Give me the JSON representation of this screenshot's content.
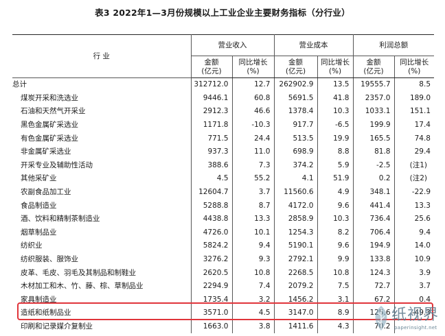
{
  "title": "表3  2022年1—3月份规模以上工业企业主要财务指标（分行业）",
  "header": {
    "industry": "行    业",
    "groups": [
      "营业收入",
      "营业成本",
      "利润总额"
    ],
    "amount_line1": "金额",
    "amount_line2": "(亿元)",
    "growth_line1": "同比增长",
    "growth_line2": "(%)"
  },
  "rows": [
    {
      "name": "总计",
      "v": [
        "312712.0",
        "12.7",
        "262902.9",
        "13.5",
        "19555.7",
        "8.5"
      ]
    },
    {
      "name": "煤炭开采和洗选业",
      "v": [
        "9446.1",
        "60.8",
        "5691.5",
        "41.8",
        "2357.0",
        "189.0"
      ]
    },
    {
      "name": "石油和天然气开采业",
      "v": [
        "2912.3",
        "46.6",
        "1378.4",
        "10.3",
        "1033.1",
        "151.1"
      ]
    },
    {
      "name": "黑色金属矿采选业",
      "v": [
        "1171.8",
        "-10.3",
        "917.7",
        "-6.5",
        "199.9",
        "17.4"
      ]
    },
    {
      "name": "有色金属矿采选业",
      "v": [
        "771.5",
        "24.4",
        "513.5",
        "19.9",
        "165.5",
        "74.8"
      ]
    },
    {
      "name": "非金属矿采选业",
      "v": [
        "937.3",
        "11.0",
        "698.9",
        "8.8",
        "81.8",
        "29.4"
      ]
    },
    {
      "name": "开采专业及辅助性活动",
      "v": [
        "388.6",
        "7.3",
        "374.2",
        "5.9",
        "-2.5",
        "(注1)"
      ]
    },
    {
      "name": "其他采矿业",
      "v": [
        "4.5",
        "55.2",
        "4.1",
        "51.9",
        "0.2",
        "(注2)"
      ]
    },
    {
      "name": "农副食品加工业",
      "v": [
        "12604.7",
        "3.7",
        "11560.6",
        "4.9",
        "348.1",
        "-22.9"
      ]
    },
    {
      "name": "食品制造业",
      "v": [
        "5288.8",
        "8.7",
        "4172.0",
        "9.6",
        "441.4",
        "13.3"
      ]
    },
    {
      "name": "酒、饮料和精制茶制造业",
      "v": [
        "4438.8",
        "13.3",
        "2858.9",
        "10.3",
        "736.4",
        "25.6"
      ]
    },
    {
      "name": "烟草制品业",
      "v": [
        "4726.0",
        "10.1",
        "1254.3",
        "8.2",
        "706.4",
        "9.4"
      ]
    },
    {
      "name": "纺织业",
      "v": [
        "5824.2",
        "9.4",
        "5190.1",
        "9.6",
        "194.9",
        "14.0"
      ]
    },
    {
      "name": "纺织服装、服饰业",
      "v": [
        "3276.2",
        "9.3",
        "2792.1",
        "9.9",
        "133.8",
        "10.9"
      ]
    },
    {
      "name": "皮革、毛皮、羽毛及其制品和制鞋业",
      "v": [
        "2620.5",
        "10.8",
        "2268.5",
        "10.8",
        "124.3",
        "3.9"
      ]
    },
    {
      "name": "木材加工和木、竹、藤、棕、草制品业",
      "v": [
        "2294.9",
        "7.4",
        "2079.2",
        "7.5",
        "72.7",
        "3.7"
      ]
    },
    {
      "name": "家具制造业",
      "v": [
        "1735.4",
        "3.2",
        "1456.2",
        "3.1",
        "67.2",
        "0.4"
      ]
    },
    {
      "name": "造纸和纸制品业",
      "v": [
        "3571.0",
        "4.5",
        "3147.0",
        "8.9",
        "125.6",
        "-49.3"
      ]
    },
    {
      "name": "印刷和记录媒介复制业",
      "v": [
        "1663.0",
        "3.8",
        "1411.6",
        "4.3",
        "70.2",
        ""
      ]
    }
  ],
  "highlight_row_name": "造纸和纸制品业",
  "highlight_color": "#e0343a",
  "watermark": {
    "text": "纸视界",
    "url": "paperinsight.net",
    "icon": "paper-leaf-logo-icon"
  }
}
